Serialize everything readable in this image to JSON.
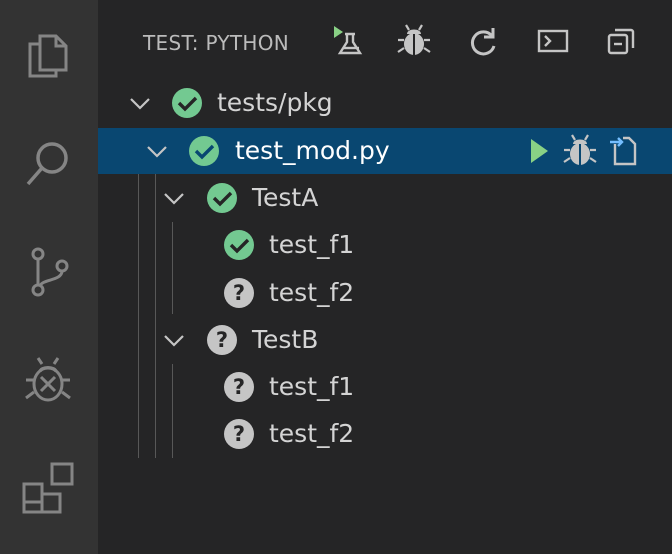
{
  "activity_bar": {
    "items": [
      "files-icon",
      "search-icon",
      "source-control-icon",
      "debug-icon",
      "extensions-icon"
    ]
  },
  "header": {
    "title": "TEST: PYTHON",
    "actions": [
      "run-all-tests-icon",
      "debug-all-tests-icon",
      "refresh-icon",
      "terminal-icon",
      "collapse-all-icon"
    ]
  },
  "tree": {
    "rows": [
      {
        "label": "tests/pkg",
        "status": "passed",
        "expanded": true
      },
      {
        "label": "test_mod.py",
        "status": "passed",
        "expanded": true,
        "selected": true
      },
      {
        "label": "TestA",
        "status": "passed",
        "expanded": true
      },
      {
        "label": "test_f1",
        "status": "passed"
      },
      {
        "label": "test_f2",
        "status": "unknown"
      },
      {
        "label": "TestB",
        "status": "unknown",
        "expanded": true
      },
      {
        "label": "test_f1",
        "status": "unknown"
      },
      {
        "label": "test_f2",
        "status": "unknown"
      }
    ],
    "selected_row_actions": [
      "run-test-icon",
      "debug-test-icon",
      "open-file-icon"
    ]
  },
  "colors": {
    "passed": "#73c991",
    "unknown": "#c5c5c5",
    "selected_bg": "#094771",
    "run_green": "#89d185",
    "accent_blue": "#75beff"
  }
}
